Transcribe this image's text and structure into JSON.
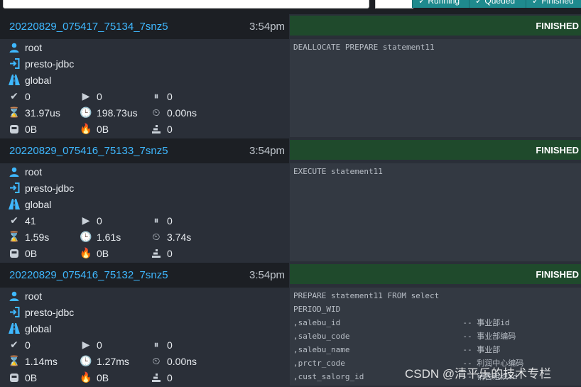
{
  "toolbar": {
    "state_buttons": [
      "✓ Running",
      "✓ Queued",
      "✓ Finished"
    ]
  },
  "queries": [
    {
      "id": "20220829_075417_75134_7snz5",
      "time": "3:54pm",
      "state": "FINISHED",
      "user": "root",
      "source": "presto-jdbc",
      "resource_group": "global",
      "completed_splits": "0",
      "running_splits": "0",
      "queued_splits": "0",
      "wall_time": "31.97us",
      "elapsed_time": "198.73us",
      "cpu_time": "0.00ns",
      "current_memory": "0B",
      "peak_memory": "0B",
      "cumulative_memory": "0",
      "sql": [
        "DEALLOCATE PREPARE statement11"
      ]
    },
    {
      "id": "20220829_075416_75133_7snz5",
      "time": "3:54pm",
      "state": "FINISHED",
      "user": "root",
      "source": "presto-jdbc",
      "resource_group": "global",
      "completed_splits": "41",
      "running_splits": "0",
      "queued_splits": "0",
      "wall_time": "1.59s",
      "elapsed_time": "1.61s",
      "cpu_time": "3.74s",
      "current_memory": "0B",
      "peak_memory": "0B",
      "cumulative_memory": "0",
      "sql": [
        "EXECUTE statement11"
      ]
    },
    {
      "id": "20220829_075416_75132_7snz5",
      "time": "3:54pm",
      "state": "FINISHED",
      "user": "root",
      "source": "presto-jdbc",
      "resource_group": "global",
      "completed_splits": "0",
      "running_splits": "0",
      "queued_splits": "0",
      "wall_time": "1.14ms",
      "elapsed_time": "1.27ms",
      "cpu_time": "0.00ns",
      "current_memory": "0B",
      "peak_memory": "0B",
      "cumulative_memory": "0",
      "sql": [
        "PREPARE statement11 FROM select",
        "PERIOD_WID",
        ",salebu_id                          -- 事业部id",
        ",salebu_code                        -- 事业部编码",
        ",salebu_name                        -- 事业部",
        ",prctr_code                         -- 利润中心编码",
        ",cust_salorg_id                     -- 销售组织id"
      ]
    }
  ],
  "watermark": "CSDN @清平乐的技术专栏"
}
